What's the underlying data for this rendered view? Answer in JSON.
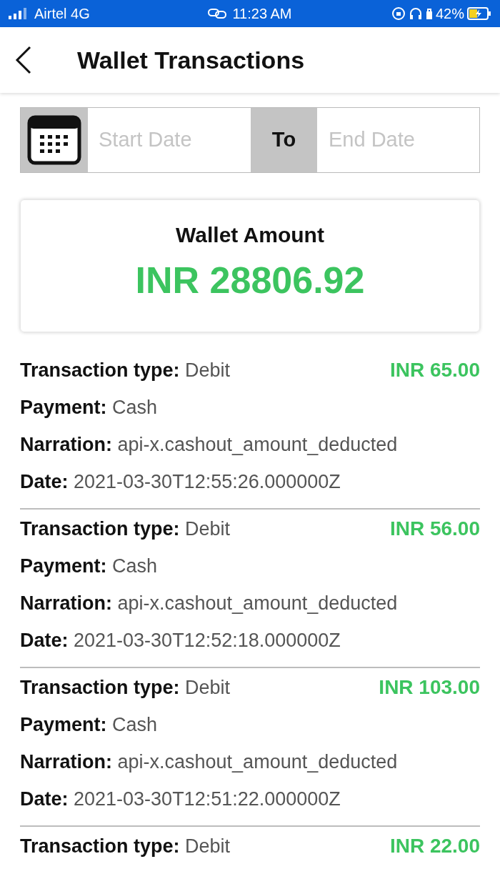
{
  "status_bar": {
    "carrier": "Airtel 4G",
    "time": "11:23 AM",
    "battery": "42%"
  },
  "header": {
    "title": "Wallet Transactions"
  },
  "date_filter": {
    "start_placeholder": "Start Date",
    "separator": "To",
    "end_placeholder": "End Date"
  },
  "wallet": {
    "label": "Wallet Amount",
    "amount": "INR 28806.92"
  },
  "transactions": [
    {
      "amount": "INR 65.00",
      "fields": [
        {
          "label": "Transaction type:",
          "value": "Debit"
        },
        {
          "label": "Payment:",
          "value": "Cash"
        },
        {
          "label": "Narration:",
          "value": "api-x.cashout_amount_deducted"
        },
        {
          "label": "Date:",
          "value": "2021-03-30T12:55:26.000000Z"
        }
      ]
    },
    {
      "amount": "INR 56.00",
      "fields": [
        {
          "label": "Transaction type:",
          "value": "Debit"
        },
        {
          "label": "Payment:",
          "value": "Cash"
        },
        {
          "label": "Narration:",
          "value": "api-x.cashout_amount_deducted"
        },
        {
          "label": "Date:",
          "value": "2021-03-30T12:52:18.000000Z"
        }
      ]
    },
    {
      "amount": "INR 103.00",
      "fields": [
        {
          "label": "Transaction type:",
          "value": "Debit"
        },
        {
          "label": "Payment:",
          "value": "Cash"
        },
        {
          "label": "Narration:",
          "value": "api-x.cashout_amount_deducted"
        },
        {
          "label": "Date:",
          "value": "2021-03-30T12:51:22.000000Z"
        }
      ]
    },
    {
      "amount": "INR 22.00",
      "fields": [
        {
          "label": "Transaction type:",
          "value": "Debit"
        }
      ]
    }
  ]
}
